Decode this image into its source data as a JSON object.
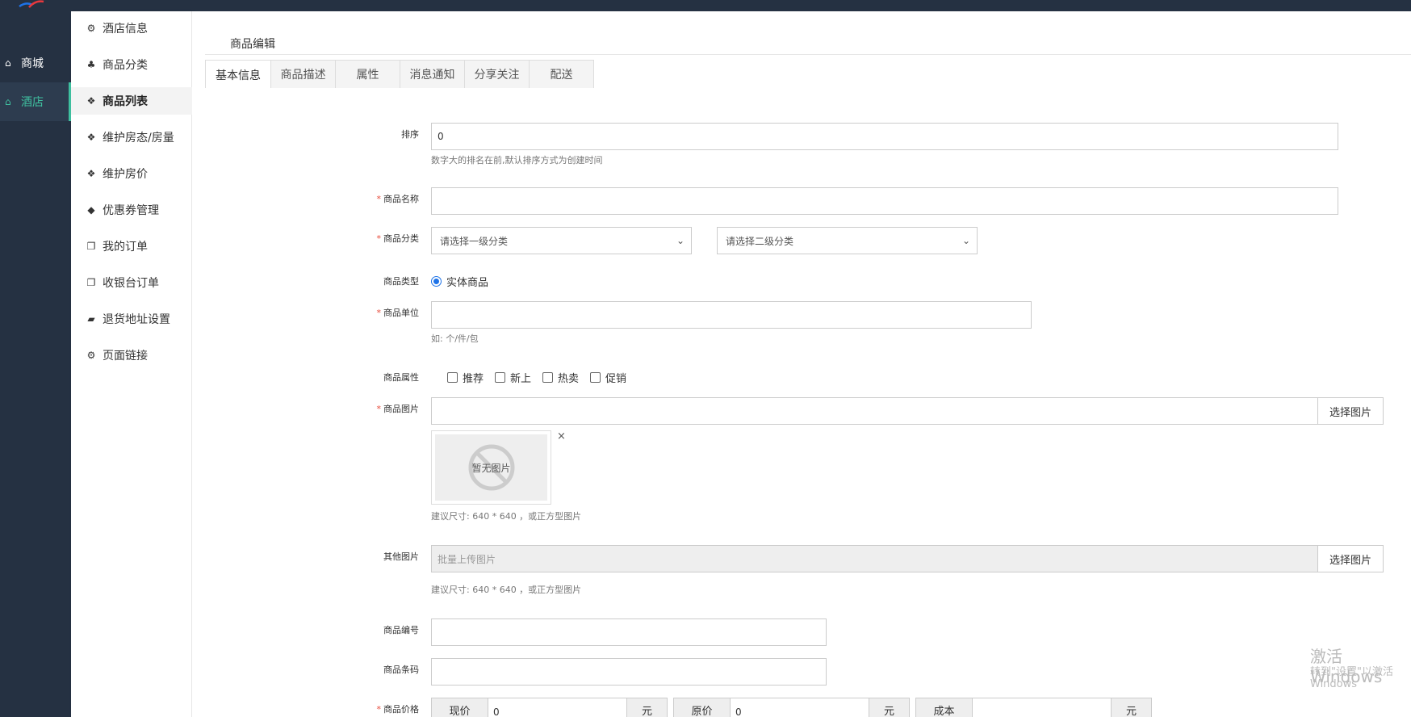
{
  "leftnav": {
    "items": [
      {
        "label": "商城",
        "icon": "home-icon"
      },
      {
        "label": "酒店",
        "icon": "home-icon"
      }
    ]
  },
  "subnav": {
    "items": [
      {
        "label": "酒店信息",
        "icon": "gears-icon"
      },
      {
        "label": "商品分类",
        "icon": "sitemap-icon"
      },
      {
        "label": "商品列表",
        "icon": "cubes-icon"
      },
      {
        "label": "维护房态/房量",
        "icon": "cubes-icon"
      },
      {
        "label": "维护房价",
        "icon": "cubes-icon"
      },
      {
        "label": "优惠券管理",
        "icon": "tags-icon"
      },
      {
        "label": "我的订单",
        "icon": "copy-icon"
      },
      {
        "label": "收银台订单",
        "icon": "copy-icon"
      },
      {
        "label": "退货地址设置",
        "icon": "truck-icon"
      },
      {
        "label": "页面链接",
        "icon": "gears-icon"
      }
    ]
  },
  "page": {
    "title": "商品编辑"
  },
  "tabs": [
    "基本信息",
    "商品描述",
    "属性",
    "消息通知",
    "分享关注",
    "配送"
  ],
  "form": {
    "sort": {
      "label": "排序",
      "value": "0",
      "help": "数字大的排名在前,默认排序方式为创建时间"
    },
    "name": {
      "label": "商品名称",
      "value": ""
    },
    "category": {
      "label": "商品分类",
      "first": "请选择一级分类",
      "second": "请选择二级分类"
    },
    "type": {
      "label": "商品类型",
      "option": "实体商品"
    },
    "unit": {
      "label": "商品单位",
      "value": "",
      "help": "如: 个/件/包"
    },
    "attrs": {
      "label": "商品属性",
      "options": [
        "推荐",
        "新上",
        "热卖",
        "促销"
      ]
    },
    "image": {
      "label": "商品图片",
      "button": "选择图片",
      "noimg": "暂无图片",
      "close": "×",
      "help": "建议尺寸: 640 * 640 ，或正方型图片"
    },
    "others": {
      "label": "其他图片",
      "placeholder": "批量上传图片",
      "button": "选择图片",
      "help": "建议尺寸: 640 * 640 ，或正方型图片"
    },
    "code": {
      "label": "商品编号",
      "value": ""
    },
    "barcode": {
      "label": "商品条码",
      "value": ""
    },
    "price": {
      "label": "商品价格",
      "current": "现价",
      "current_val": "0",
      "original": "原价",
      "original_val": "0",
      "cost": "成本",
      "cost_val": "",
      "unit": "元"
    }
  },
  "watermark": {
    "line1": "激活 Windows",
    "line2": "转到\"设置\"以激活 Windows"
  }
}
